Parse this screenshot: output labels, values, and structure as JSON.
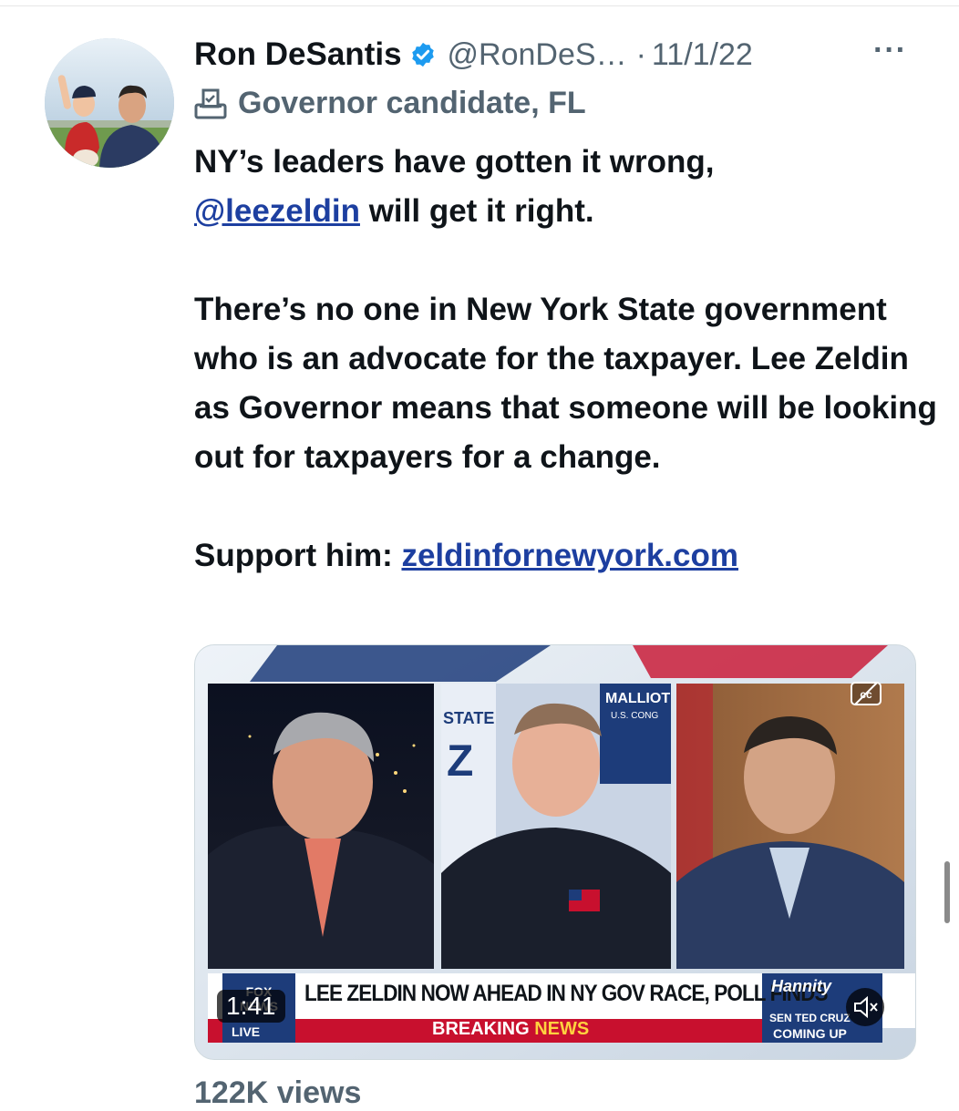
{
  "tweet": {
    "author_name": "Ron DeSantis",
    "handle": "@RonDeS…",
    "separator": "·",
    "date": "11/1/22",
    "more": "···",
    "label": "Governor candidate, FL",
    "line1": "NY’s leaders have gotten it wrong,",
    "mention": "@leezeldin",
    "line2_rest": " will get it right.",
    "para2": "There’s no one in New York State government who is an advocate for the taxpayer. Lee Zeldin as Governor means that someone will be looking out for taxpayers for a change.",
    "support_prefix": "Support him: ",
    "support_link": "zeldinfornewyork.com",
    "views": "122K views"
  },
  "video": {
    "duration": "1:41",
    "headline": "LEE ZELDIN NOW AHEAD IN NY GOV RACE, POLL FINDS",
    "breaking": "BREAKING",
    "news": "NEWS",
    "network": "FOX NEWS",
    "live": "LIVE",
    "show": "Hannity",
    "sidebar_top": "SEN TED CRUZ",
    "sidebar_bottom": "COMING UP",
    "bg_sign_left": "STATE",
    "bg_sign_letter": "Z",
    "bg_sign_right_top": "MALLIOT",
    "bg_sign_right_sub": "U.S. CONG"
  },
  "colors": {
    "text": "#0f1419",
    "muted": "#536471",
    "link": "#1d3fa0",
    "verified": "#1d9bf0",
    "fox_red": "#c8102e",
    "fox_blue": "#1d3c7a"
  },
  "icons": {
    "verified": "verified-badge-icon",
    "label": "ballot-box-icon",
    "more": "more-options-icon",
    "cc": "closed-captions-icon",
    "mute": "volume-muted-icon"
  }
}
